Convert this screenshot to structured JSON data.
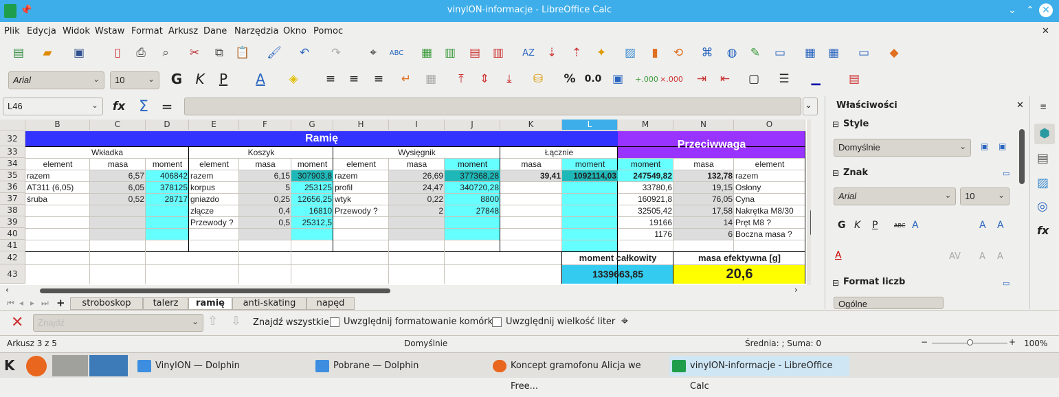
{
  "window": {
    "title": "vinylON-informacje - LibreOffice Calc"
  },
  "menu": [
    "Plik",
    "Edycja",
    "Widok",
    "Wstaw",
    "Format",
    "Arkusz",
    "Dane",
    "Narzędzia",
    "Okno",
    "Pomoc"
  ],
  "format": {
    "font": "Arial",
    "size": "10"
  },
  "formula": {
    "cell_ref": "L46",
    "content": ""
  },
  "columns": [
    "B",
    "C",
    "D",
    "E",
    "F",
    "G",
    "H",
    "I",
    "J",
    "K",
    "L",
    "M",
    "N",
    "O"
  ],
  "rows": [
    "32",
    "33",
    "34",
    "35",
    "36",
    "37",
    "38",
    "39",
    "40",
    "41",
    "42",
    "43"
  ],
  "sheet": {
    "title_ramie": "Ramię",
    "title_przeciw": "Przeciwwaga",
    "group_wkladka": "Wkładka",
    "group_koszyk": "Koszyk",
    "group_wysiegnik": "Wysięgnik",
    "group_lacznie": "Łącznie",
    "h_element": "element",
    "h_masa": "masa",
    "h_moment": "moment",
    "wkladka": [
      {
        "element": "razem",
        "masa": "6,57",
        "moment": "406842"
      },
      {
        "element": "AT311 (6,05)",
        "masa": "6,05",
        "moment": "378125"
      },
      {
        "element": "śruba",
        "masa": "0,52",
        "moment": "28717"
      }
    ],
    "koszyk": [
      {
        "element": "razem",
        "masa": "6,15",
        "moment": "307903,8"
      },
      {
        "element": "korpus",
        "masa": "5",
        "moment": "253125"
      },
      {
        "element": "gniazdo",
        "masa": "0,25",
        "moment": "12656,25"
      },
      {
        "element": "złącze",
        "masa": "0,4",
        "moment": "16810"
      },
      {
        "element": "Przewody ?",
        "masa": "0,5",
        "moment": "25312,5"
      }
    ],
    "wysiegnik": [
      {
        "element": "razem",
        "masa": "26,69",
        "moment": "377368,28"
      },
      {
        "element": "profil",
        "masa": "24,47",
        "moment": "340720,28"
      },
      {
        "element": "wtyk",
        "masa": "0,22",
        "moment": "8800"
      },
      {
        "element": "Przewody ?",
        "masa": "2",
        "moment": "27848"
      }
    ],
    "lacznie": {
      "masa": "39,41",
      "moment": "1092114,03"
    },
    "przeciwwaga": [
      {
        "moment": "247549,82",
        "masa": "132,78",
        "element": "razem"
      },
      {
        "moment": "33780,6",
        "masa": "19,15",
        "element": "Osłony"
      },
      {
        "moment": "160921,8",
        "masa": "76,05",
        "element": "Cyna"
      },
      {
        "moment": "32505,42",
        "masa": "17,58",
        "element": "Nakrętka M8/30"
      },
      {
        "moment": "19166",
        "masa": "14",
        "element": "Pręt M8 ?"
      },
      {
        "moment": "1176",
        "masa": "6",
        "element": "Boczna masa ?"
      }
    ],
    "moment_total_label": "moment całkowity",
    "moment_total": "1339663,85",
    "masa_eff_label": "masa efektywna [g]",
    "masa_eff": "20,6"
  },
  "sidebar": {
    "title": "Właściwości",
    "style_section": "Style",
    "style_value": "Domyślnie",
    "znak_section": "Znak",
    "font": "Arial",
    "size": "10",
    "format_section": "Format liczb",
    "format_value": "Ogólne"
  },
  "tabs": [
    "stroboskop",
    "talerz",
    "ramię",
    "anti-skating",
    "napęd"
  ],
  "findbar": {
    "placeholder": "Znajdź",
    "find_all": "Znajdź wszystkie",
    "opt1": "Uwzględnij formatowanie komórki",
    "opt2": "Uwzględnij wielkość liter"
  },
  "status": {
    "sheet": "Arkusz 3 z 5",
    "style": "Domyślnie",
    "summary": "Średnia: ; Suma: 0",
    "zoom": "100%"
  },
  "taskbar": [
    "VinylON — Dolphin",
    "Pobrane — Dolphin",
    "Koncept gramofonu Alicja we Free...",
    "vinylON-informacje - LibreOffice Calc"
  ],
  "colors": {
    "blue_header": "#3333ff",
    "purple_header": "#9933ff",
    "cyan": "#66ffff",
    "grey": "#dddddd",
    "yellow": "#ffff00",
    "teal": "#33ccdd"
  }
}
